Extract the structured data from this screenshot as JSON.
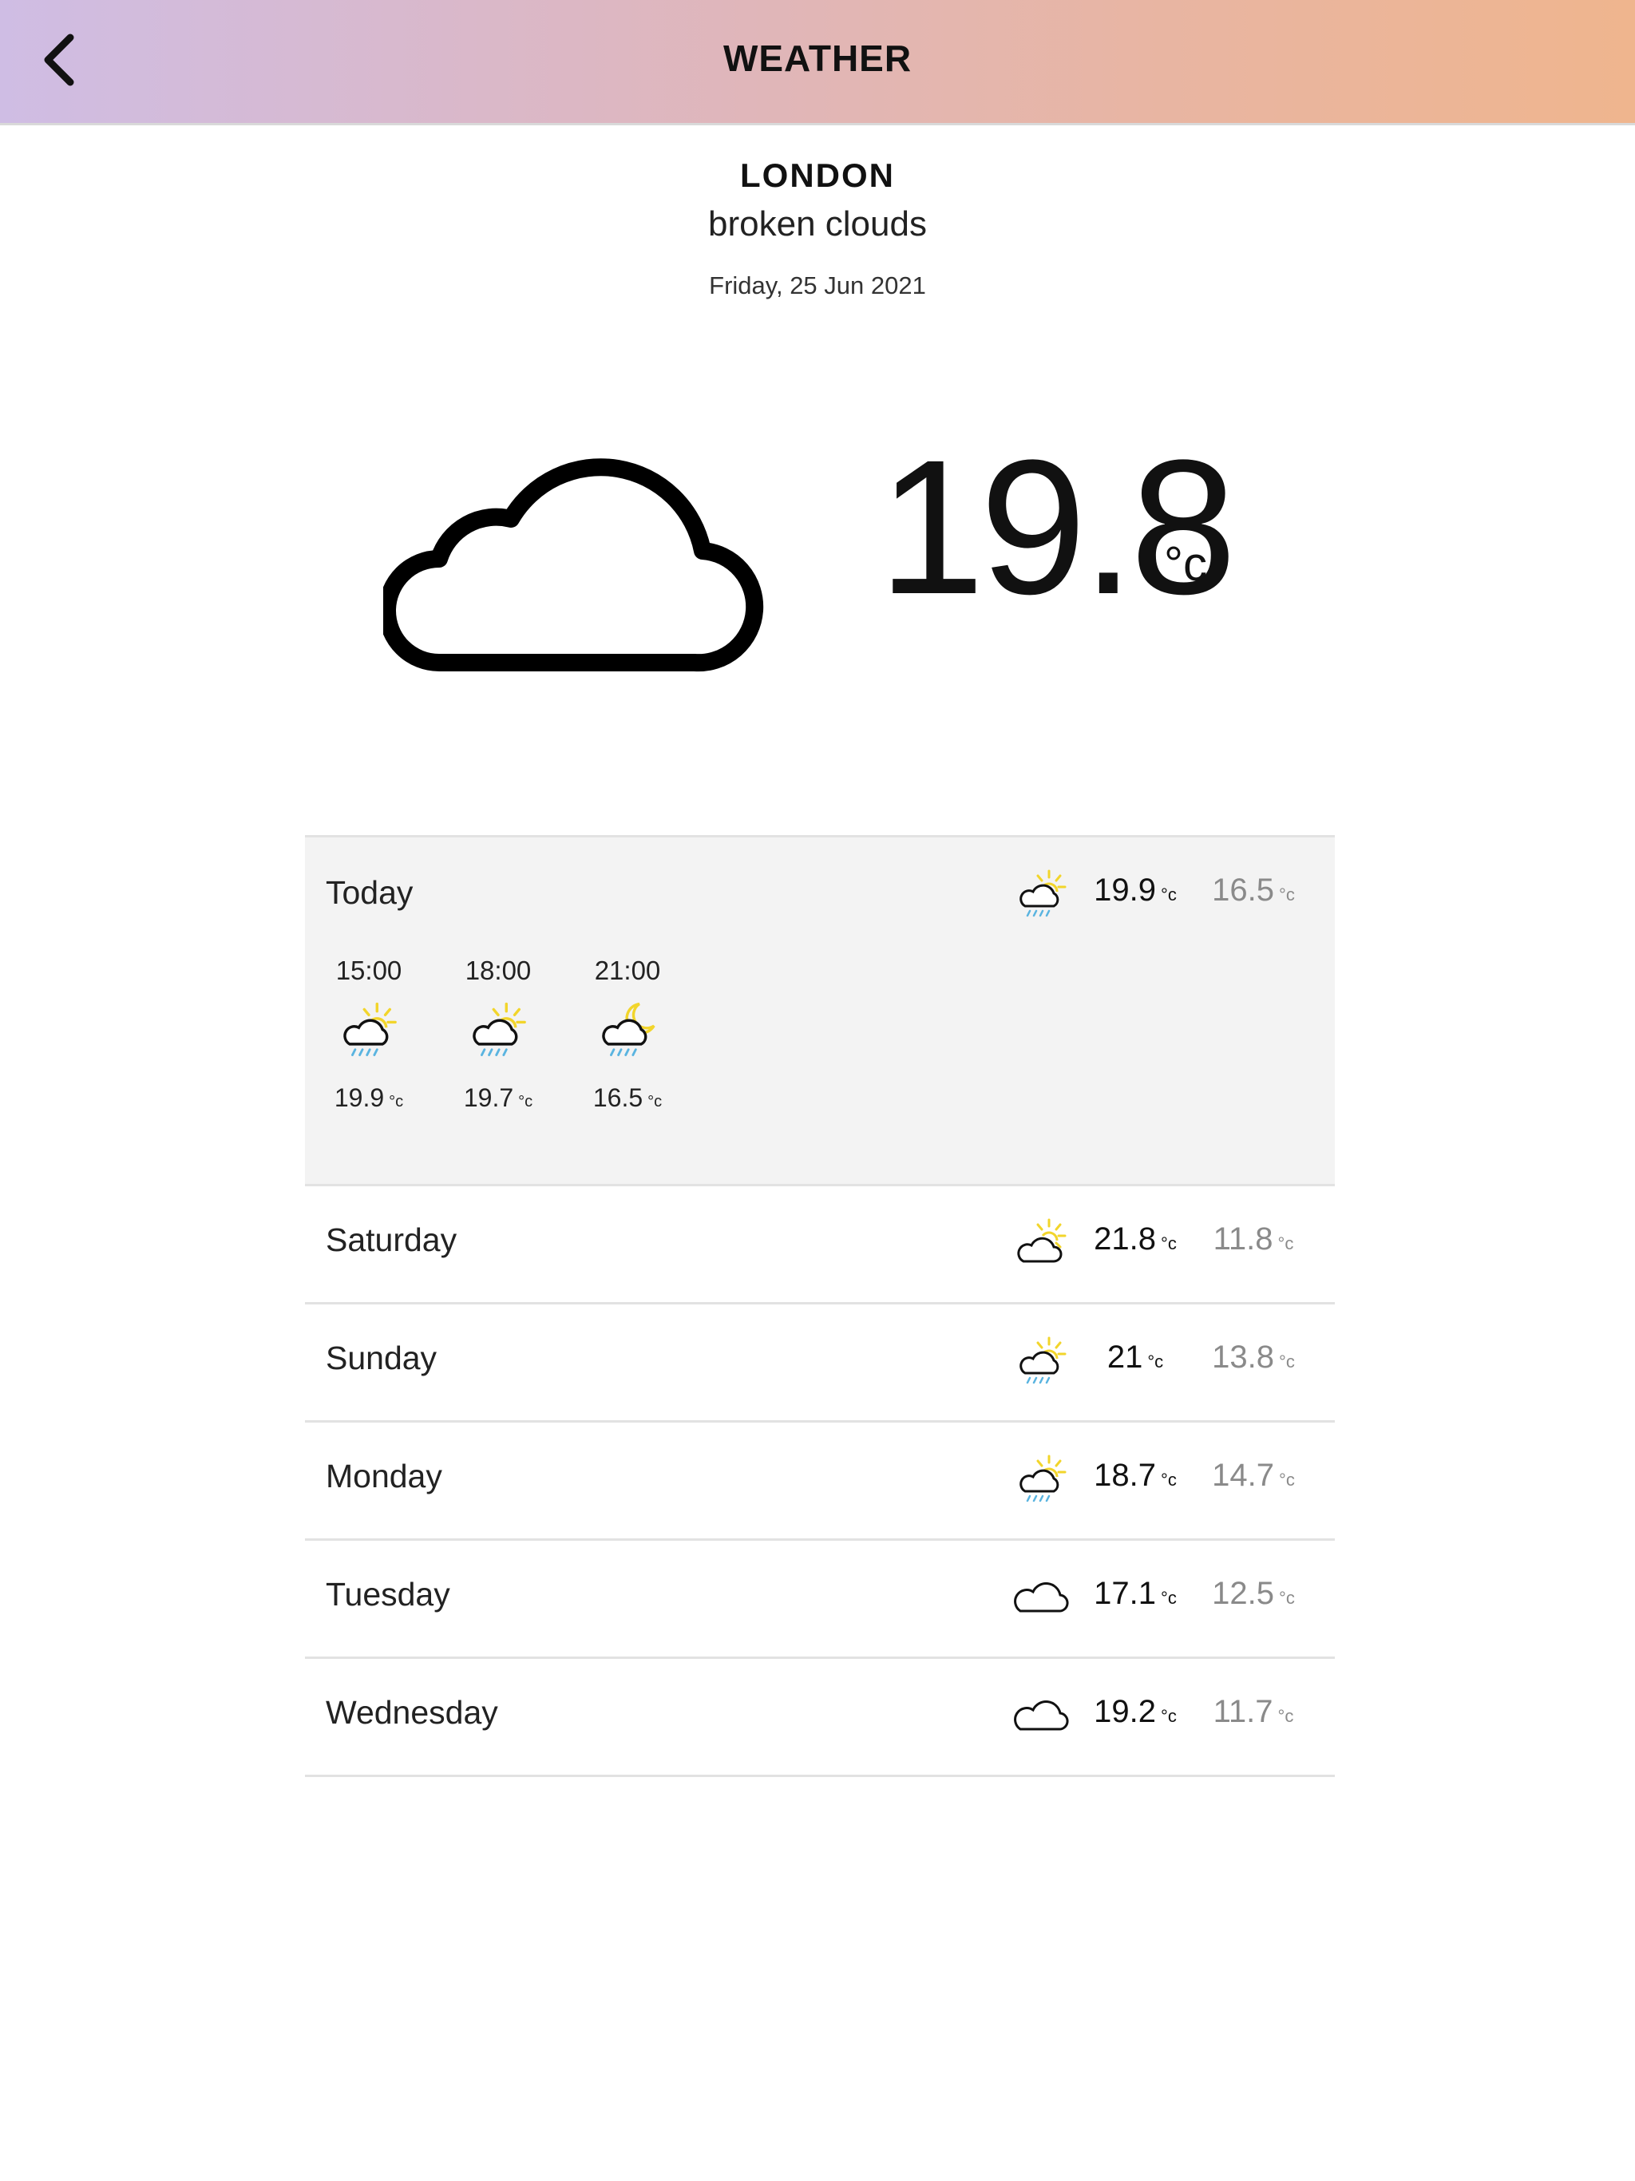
{
  "header": {
    "title": "WEATHER",
    "back_icon": "chevron-left-icon"
  },
  "current": {
    "city": "LONDON",
    "description": "broken clouds",
    "date": "Friday, 25 Jun 2021",
    "temperature": "19.8",
    "unit": "°c",
    "icon": "cloud-icon"
  },
  "today": {
    "label": "Today",
    "icon": "sun-cloud-rain-icon",
    "high": "19.9",
    "low": "16.5",
    "unit": "°c",
    "hours": [
      {
        "time": "15:00",
        "icon": "sun-cloud-rain-icon",
        "temp": "19.9",
        "unit": "°c"
      },
      {
        "time": "18:00",
        "icon": "sun-cloud-rain-icon",
        "temp": "19.7",
        "unit": "°c"
      },
      {
        "time": "21:00",
        "icon": "moon-cloud-rain-icon",
        "temp": "16.5",
        "unit": "°c"
      }
    ]
  },
  "days": [
    {
      "name": "Saturday",
      "icon": "sun-cloud-icon",
      "high": "21.8",
      "low": "11.8",
      "unit": "°c"
    },
    {
      "name": "Sunday",
      "icon": "sun-cloud-rain-icon",
      "high": "21",
      "low": "13.8",
      "unit": "°c"
    },
    {
      "name": "Monday",
      "icon": "sun-cloud-rain-icon",
      "high": "18.7",
      "low": "14.7",
      "unit": "°c"
    },
    {
      "name": "Tuesday",
      "icon": "cloud-icon",
      "high": "17.1",
      "low": "12.5",
      "unit": "°c"
    },
    {
      "name": "Wednesday",
      "icon": "cloud-icon",
      "high": "19.2",
      "low": "11.7",
      "unit": "°c"
    }
  ],
  "colors": {
    "sun": "#f2d52b",
    "rain": "#5ab4e0",
    "low_temp": "#8a8a8a",
    "today_bg": "#f3f3f3"
  }
}
